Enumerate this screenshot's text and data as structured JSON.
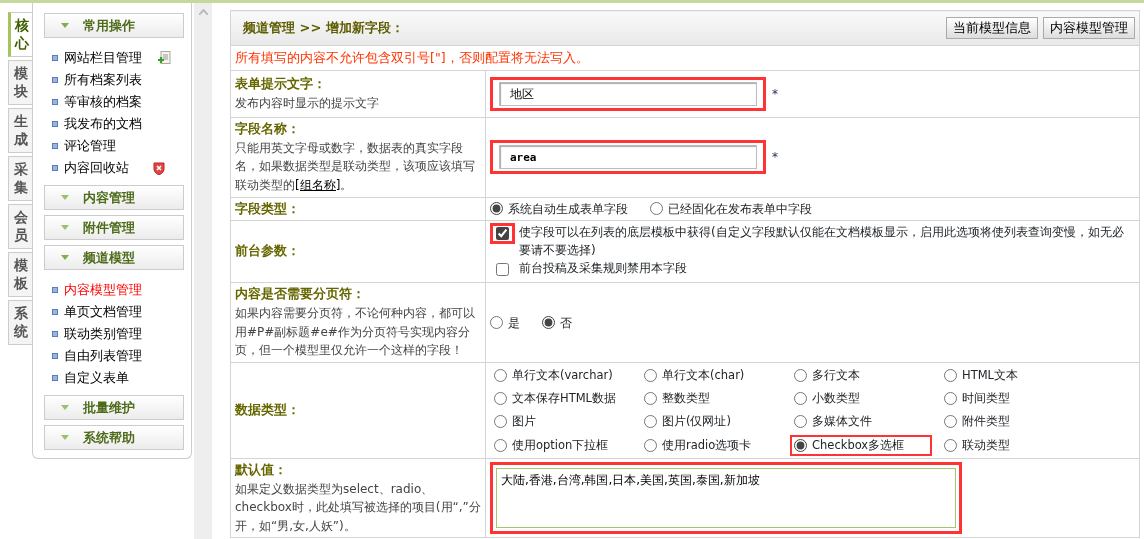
{
  "side_tabs": [
    {
      "label": "核心",
      "selected": true
    },
    {
      "label": "模块",
      "selected": false
    },
    {
      "label": "生成",
      "selected": false
    },
    {
      "label": "采集",
      "selected": false
    },
    {
      "label": "会员",
      "selected": false
    },
    {
      "label": "模板",
      "selected": false
    },
    {
      "label": "系统",
      "selected": false
    }
  ],
  "sidebar": {
    "groups": [
      {
        "title": "常用操作",
        "expanded": true,
        "items": [
          {
            "label": "网站栏目管理",
            "selected": false,
            "kind": "add"
          },
          {
            "label": "所有档案列表",
            "selected": false,
            "kind": "plain"
          },
          {
            "label": "等审核的档案",
            "selected": false,
            "kind": "plain"
          },
          {
            "label": "我发布的文档",
            "selected": false,
            "kind": "plain"
          },
          {
            "label": "评论管理",
            "selected": false,
            "kind": "plain"
          },
          {
            "label": "内容回收站",
            "selected": false,
            "kind": "remove"
          }
        ]
      },
      {
        "title": "内容管理",
        "expanded": false
      },
      {
        "title": "附件管理",
        "expanded": false
      },
      {
        "title": "频道模型",
        "expanded": true,
        "items": [
          {
            "label": "内容模型管理",
            "selected": true,
            "kind": "plain"
          },
          {
            "label": "单页文档管理",
            "selected": false,
            "kind": "plain"
          },
          {
            "label": "联动类别管理",
            "selected": false,
            "kind": "plain"
          },
          {
            "label": "自由列表管理",
            "selected": false,
            "kind": "plain"
          },
          {
            "label": "自定义表单",
            "selected": false,
            "kind": "plain"
          }
        ]
      },
      {
        "title": "批量维护",
        "expanded": false
      },
      {
        "title": "系统帮助",
        "expanded": false
      }
    ]
  },
  "header": {
    "breadcrumb": "频道管理 >> 增加新字段：",
    "buttons": [
      "当前模型信息",
      "内容模型管理"
    ]
  },
  "notice": "所有填写的内容不允许包含双引号[\"]，否则配置将无法写入。",
  "rows": [
    {
      "kind": "input",
      "title": "表单提示文字：",
      "desc": "发布内容时显示的提示文字",
      "value": "地区",
      "required": "*",
      "annotated": true
    },
    {
      "kind": "code-input",
      "title": "字段名称：",
      "desc_before": "只能用英文字母或数字，数据表的真实字段名，如果数据类型是联动类型，该项应该填写联动类型的",
      "link": "[组名称]",
      "desc_after": "。",
      "value": "area",
      "required": "*",
      "annotated": true
    },
    {
      "kind": "radios",
      "title": "字段类型：",
      "options": [
        {
          "label": "系统自动生成表单字段",
          "selected": true
        },
        {
          "label": "已经固化在发布表单中字段",
          "selected": false
        }
      ]
    },
    {
      "kind": "checks",
      "title": "前台参数：",
      "options": [
        {
          "label": "使字段可以在列表的底层模板中获得(自定义字段默认仅能在文档模板显示，启用此选项将使列表查询变慢，如无必要请不要选择)",
          "checked": true,
          "annotated": true
        },
        {
          "label": "前台投稿及采集规则禁用本字段",
          "checked": false,
          "annotated": false
        }
      ]
    },
    {
      "kind": "radios",
      "title": "内容是否需要分页符：",
      "desc": "如果内容需要分页符，不论何种内容，都可以用#P#副标题#e#作为分页符号实现内容分页，但一个模型里仅允许一个这样的字段！",
      "options": [
        {
          "label": "是",
          "selected": false
        },
        {
          "label": "否",
          "selected": true
        }
      ]
    },
    {
      "kind": "grid",
      "title": "数据类型：",
      "options": [
        {
          "label": "单行文本(varchar)",
          "selected": false,
          "annotated": false
        },
        {
          "label": "单行文本(char)",
          "selected": false,
          "annotated": false
        },
        {
          "label": "多行文本",
          "selected": false,
          "annotated": false
        },
        {
          "label": "HTML文本",
          "selected": false,
          "annotated": false
        },
        {
          "label": "文本保存HTML数据",
          "selected": false,
          "annotated": false
        },
        {
          "label": "整数类型",
          "selected": false,
          "annotated": false
        },
        {
          "label": "小数类型",
          "selected": false,
          "annotated": false
        },
        {
          "label": "时间类型",
          "selected": false,
          "annotated": false
        },
        {
          "label": "图片",
          "selected": false,
          "annotated": false
        },
        {
          "label": "图片(仅网址)",
          "selected": false,
          "annotated": false
        },
        {
          "label": "多媒体文件",
          "selected": false,
          "annotated": false
        },
        {
          "label": "附件类型",
          "selected": false,
          "annotated": false
        },
        {
          "label": "使用option下拉框",
          "selected": false,
          "annotated": false
        },
        {
          "label": "使用radio选项卡",
          "selected": false,
          "annotated": false
        },
        {
          "label": "Checkbox多选框",
          "selected": true,
          "annotated": true
        },
        {
          "label": "联动类型",
          "selected": false,
          "annotated": false
        }
      ]
    },
    {
      "kind": "textarea",
      "title": "默认值：",
      "desc": "如果定义数据类型为select、radio、checkbox时，此处填写被选择的项目(用“,”分开，如“男,女,人妖”)。",
      "value": "大陆,香港,台湾,韩国,日本,美国,英国,泰国,新加坡",
      "annotated": true
    }
  ]
}
